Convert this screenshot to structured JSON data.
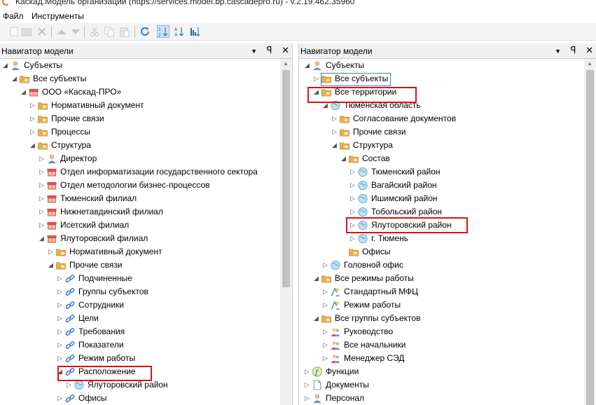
{
  "window": {
    "title": "Каскад.Модель организации (https://services.model.bp.cascadepro.ru) - v.2.19.462.35960"
  },
  "menu": {
    "file": "Файл",
    "tools": "Инструменты"
  },
  "toolbar_icons": [
    "new-icon",
    "folder-icon",
    "delete-icon",
    "up-icon",
    "down-icon",
    "cut-icon",
    "copy-icon",
    "paste-icon",
    "refresh-icon",
    "sort-az-icon",
    "sort-za-icon",
    "sort-order-icon"
  ],
  "left_panel": {
    "title": "Навигатор модели",
    "buttons": {
      "dropdown": "▼",
      "pin": "ꟼ",
      "close": "✕"
    },
    "rows": [
      {
        "depth": 0,
        "exp": "down",
        "icon": "person",
        "label": "Субъекты"
      },
      {
        "depth": 1,
        "exp": "down",
        "icon": "folder",
        "label": "Все субъекты"
      },
      {
        "depth": 2,
        "exp": "down",
        "icon": "org",
        "label": "ООО «Каскад-ПРО»"
      },
      {
        "depth": 3,
        "exp": "right",
        "icon": "folder",
        "label": "Нормативный документ"
      },
      {
        "depth": 3,
        "exp": "right",
        "icon": "folder",
        "label": "Прочие связи"
      },
      {
        "depth": 3,
        "exp": "right",
        "icon": "folder",
        "label": "Процессы"
      },
      {
        "depth": 3,
        "exp": "down",
        "icon": "folder",
        "label": "Структура"
      },
      {
        "depth": 4,
        "exp": "right",
        "icon": "person",
        "label": "Директор"
      },
      {
        "depth": 4,
        "exp": "right",
        "icon": "org",
        "label": "Отдел информатизации государственного сектора"
      },
      {
        "depth": 4,
        "exp": "right",
        "icon": "org",
        "label": "Отдел методологии бизнес-процессов"
      },
      {
        "depth": 4,
        "exp": "right",
        "icon": "org",
        "label": "Тюменский филиал"
      },
      {
        "depth": 4,
        "exp": "right",
        "icon": "org",
        "label": "Нижнетавдинский филиал"
      },
      {
        "depth": 4,
        "exp": "right",
        "icon": "org",
        "label": "Исетский филиал"
      },
      {
        "depth": 4,
        "exp": "down",
        "icon": "org",
        "label": "Ялуторовский филиал"
      },
      {
        "depth": 5,
        "exp": "right",
        "icon": "folder",
        "label": "Нормативный документ"
      },
      {
        "depth": 5,
        "exp": "down",
        "icon": "folder",
        "label": "Прочие связи"
      },
      {
        "depth": 6,
        "exp": "right",
        "icon": "link",
        "label": "Подчиненные"
      },
      {
        "depth": 6,
        "exp": "right",
        "icon": "link",
        "label": "Группы субъектов"
      },
      {
        "depth": 6,
        "exp": "right",
        "icon": "link",
        "label": "Сотрудники"
      },
      {
        "depth": 6,
        "exp": "right",
        "icon": "link",
        "label": "Цели"
      },
      {
        "depth": 6,
        "exp": "right",
        "icon": "link",
        "label": "Требования"
      },
      {
        "depth": 6,
        "exp": "right",
        "icon": "link",
        "label": "Показатели"
      },
      {
        "depth": 6,
        "exp": "right",
        "icon": "link",
        "label": "Режим работы"
      },
      {
        "depth": 6,
        "exp": "down",
        "icon": "link",
        "label": "Расположение"
      },
      {
        "depth": 7,
        "exp": "right",
        "icon": "globe",
        "label": "Ялуторовский район"
      },
      {
        "depth": 6,
        "exp": "right",
        "icon": "link",
        "label": "Офисы"
      }
    ]
  },
  "right_panel": {
    "title": "Навигатор модели",
    "buttons": {
      "dropdown": "▼",
      "pin": "ꟼ",
      "close": "✕"
    },
    "rows": [
      {
        "depth": 0,
        "exp": "down",
        "icon": "person",
        "label": "Субъекты"
      },
      {
        "depth": 1,
        "exp": "right",
        "icon": "folder",
        "label": "Все субъекты"
      },
      {
        "depth": 1,
        "exp": "down",
        "icon": "folder",
        "label": "Все территории"
      },
      {
        "depth": 2,
        "exp": "down",
        "icon": "globe",
        "label": "Тюменская область"
      },
      {
        "depth": 3,
        "exp": "right",
        "icon": "folder",
        "label": "Согласование документов"
      },
      {
        "depth": 3,
        "exp": "right",
        "icon": "folder",
        "label": "Прочие связи"
      },
      {
        "depth": 3,
        "exp": "down",
        "icon": "folder",
        "label": "Структура"
      },
      {
        "depth": 4,
        "exp": "down",
        "icon": "folder",
        "label": "Состав"
      },
      {
        "depth": 5,
        "exp": "right",
        "icon": "globe",
        "label": "Тюменский район"
      },
      {
        "depth": 5,
        "exp": "right",
        "icon": "globe",
        "label": "Вагайский район"
      },
      {
        "depth": 5,
        "exp": "right",
        "icon": "globe",
        "label": "Ишимский район"
      },
      {
        "depth": 5,
        "exp": "right",
        "icon": "globe",
        "label": "Тобольский район"
      },
      {
        "depth": 5,
        "exp": "right",
        "icon": "globe",
        "label": "Ялуторовский район"
      },
      {
        "depth": 5,
        "exp": "right",
        "icon": "globe",
        "label": "г. Тюмень"
      },
      {
        "depth": 4,
        "exp": "none",
        "icon": "folder",
        "label": "Офисы"
      },
      {
        "depth": 2,
        "exp": "right",
        "icon": "globe",
        "label": "Головной офис"
      },
      {
        "depth": 1,
        "exp": "down",
        "icon": "folder",
        "label": "Все режимы работы"
      },
      {
        "depth": 2,
        "exp": "right",
        "icon": "clock",
        "label": "Стандартный МФЦ"
      },
      {
        "depth": 2,
        "exp": "right",
        "icon": "clock",
        "label": "Режим работы"
      },
      {
        "depth": 1,
        "exp": "down",
        "icon": "folder",
        "label": "Все группы субъектов"
      },
      {
        "depth": 2,
        "exp": "right",
        "icon": "group",
        "label": "Руководство"
      },
      {
        "depth": 2,
        "exp": "right",
        "icon": "group",
        "label": "Все начальники"
      },
      {
        "depth": 2,
        "exp": "right",
        "icon": "group",
        "label": "Менеджер СЭД"
      },
      {
        "depth": 0,
        "exp": "right",
        "icon": "func",
        "label": "Функции"
      },
      {
        "depth": 0,
        "exp": "right",
        "icon": "doc",
        "label": "Документы"
      },
      {
        "depth": 0,
        "exp": "right",
        "icon": "person",
        "label": "Персонал"
      }
    ]
  },
  "colors": {
    "highlight": "#e01010",
    "folder": "#e8b04a",
    "link": "#3a7bd5",
    "globe": "#5aa0d8",
    "org": "#d9534f"
  }
}
